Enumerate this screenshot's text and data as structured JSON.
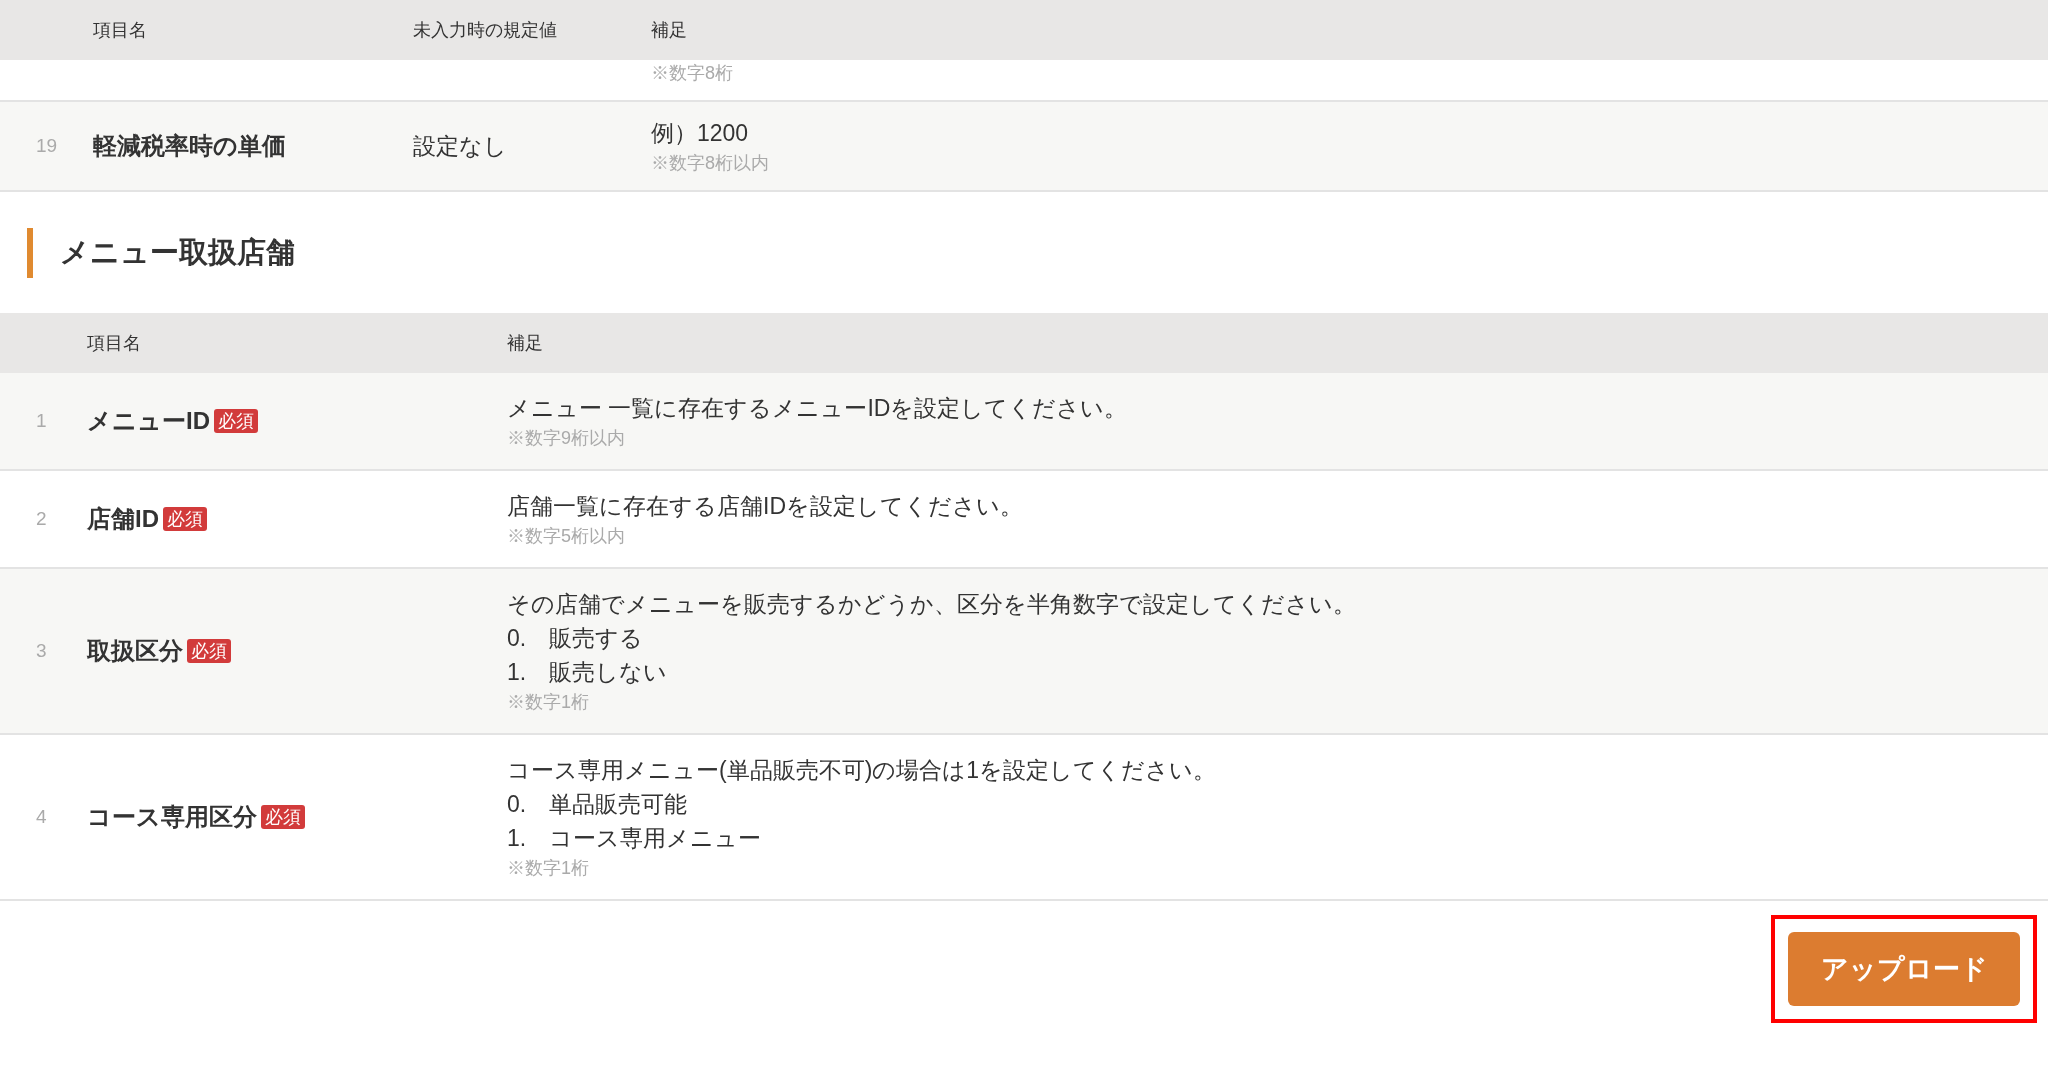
{
  "top_table": {
    "columns": [
      "項目名",
      "未入力時の規定値",
      "補足"
    ],
    "cut_row": {
      "note": "※数字8桁"
    },
    "rows": [
      {
        "number": "19",
        "name": "軽減税率時の単価",
        "default": "設定なし",
        "description": "例）1200",
        "note": "※数字8桁以内"
      }
    ]
  },
  "section": {
    "title": "メニュー取扱店舗"
  },
  "table": {
    "columns": [
      "項目名",
      "補足"
    ],
    "rows": [
      {
        "number": "1",
        "name": "メニューID",
        "required": true,
        "badge": "必須",
        "description": "メニュー 一覧に存在するメニューIDを設定してください。",
        "options": [],
        "note": "※数字9桁以内"
      },
      {
        "number": "2",
        "name": "店舗ID",
        "required": true,
        "badge": "必須",
        "description": "店舗一覧に存在する店舗IDを設定してください。",
        "options": [],
        "note": "※数字5桁以内"
      },
      {
        "number": "3",
        "name": "取扱区分",
        "required": true,
        "badge": "必須",
        "description": "その店舗でメニューを販売するかどうか、区分を半角数字で設定してください。",
        "options": [
          {
            "number": "0.",
            "label": "販売する"
          },
          {
            "number": "1.",
            "label": "販売しない"
          }
        ],
        "note": "※数字1桁"
      },
      {
        "number": "4",
        "name": "コース専用区分",
        "required": true,
        "badge": "必須",
        "description": "コース専用メニュー(単品販売不可)の場合は1を設定してください。",
        "options": [
          {
            "number": "0.",
            "label": "単品販売可能"
          },
          {
            "number": "1.",
            "label": "コース専用メニュー"
          }
        ],
        "note": "※数字1桁"
      }
    ]
  },
  "upload_button": {
    "label": "アップロード",
    "highlighted": true
  }
}
